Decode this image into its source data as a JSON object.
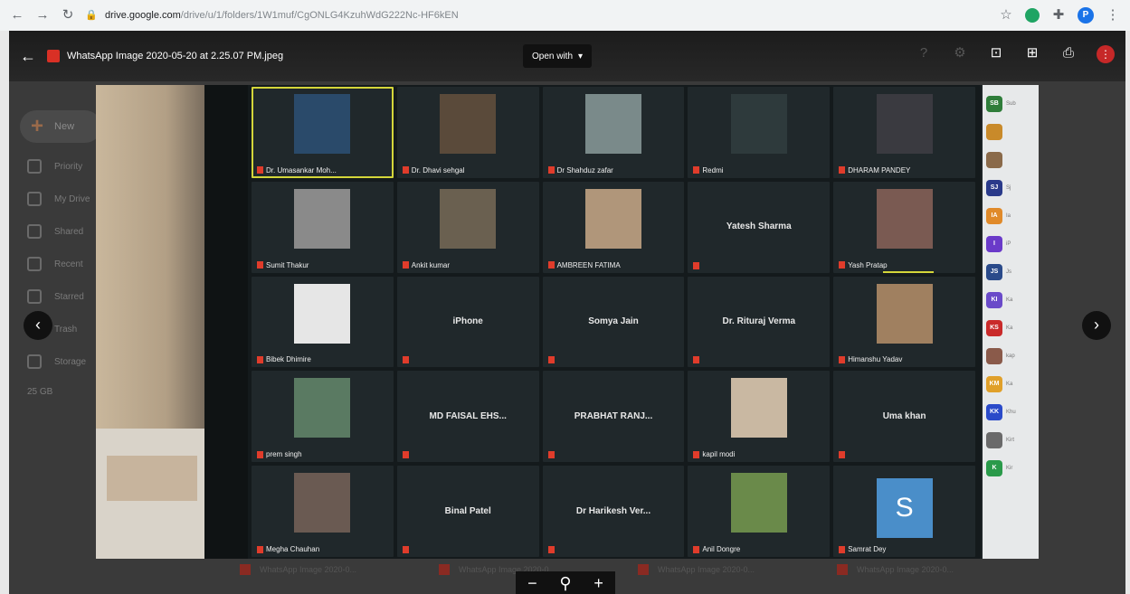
{
  "browser": {
    "url_host": "drive.google.com",
    "url_path": "/drive/u/1/folders/1W1muf/CgONLG4KzuhWdG222Nc-HF6kEN",
    "profile_initial": "P"
  },
  "viewer": {
    "file_title": "WhatsApp Image 2020-05-20 at 2.25.07 PM.jpeg",
    "open_with_label": "Open with",
    "open_with_caret": "▾",
    "back_icon": "←",
    "more_label": "⋮"
  },
  "drive_sidebar": {
    "new_label": "New",
    "items": [
      {
        "label": "Priority",
        "icon": "check-icon"
      },
      {
        "label": "My Drive",
        "icon": "drive-icon"
      },
      {
        "label": "Shared",
        "icon": "people-icon"
      },
      {
        "label": "Recent",
        "icon": "clock-icon"
      },
      {
        "label": "Starred",
        "icon": "star-icon"
      },
      {
        "label": "Trash",
        "icon": "trash-icon"
      },
      {
        "label": "Storage",
        "icon": "storage-icon"
      },
      {
        "label": "25 GB",
        "icon": ""
      }
    ]
  },
  "meeting_tiles": [
    {
      "name": "Dr. Umasankar Moh...",
      "type": "video",
      "color": "#2a4a6a",
      "active": true
    },
    {
      "name": "Dr. Dhavi sehgal",
      "type": "video",
      "color": "#5a4a3a"
    },
    {
      "name": "Dr Shahduz zafar",
      "type": "video",
      "color": "#7a8a8a"
    },
    {
      "name": "Redmi",
      "type": "video",
      "color": "#2e3a3c"
    },
    {
      "name": "DHARAM PANDEY",
      "type": "video",
      "color": "#3a3a40"
    },
    {
      "name": "Sumit Thakur",
      "type": "video",
      "color": "#8a8a8a"
    },
    {
      "name": "Ankit kumar",
      "type": "video",
      "color": "#6a6050"
    },
    {
      "name": "AMBREEN FATIMA",
      "type": "video",
      "color": "#b0967a"
    },
    {
      "name": "Yatesh Sharma",
      "type": "name"
    },
    {
      "name": "Yash Pratap",
      "type": "video",
      "color": "#7a5a52",
      "bar": true
    },
    {
      "name": "Bibek Dhimire",
      "type": "video",
      "color": "#e6e6e6"
    },
    {
      "name": "iPhone",
      "type": "name"
    },
    {
      "name": "Somya Jain",
      "type": "name"
    },
    {
      "name": "Dr. Rituraj Verma",
      "type": "name"
    },
    {
      "name": "Himanshu Yadav",
      "type": "video",
      "color": "#a08060"
    },
    {
      "name": "prem singh",
      "type": "video",
      "color": "#5a7a62"
    },
    {
      "name": "MD FAISAL EHS...",
      "type": "name"
    },
    {
      "name": "PRABHAT RANJ...",
      "type": "name"
    },
    {
      "name": "kapil modi",
      "type": "video",
      "color": "#c9b8a2"
    },
    {
      "name": "Uma khan",
      "type": "name"
    },
    {
      "name": "Megha Chauhan",
      "type": "video",
      "color": "#6a5a52"
    },
    {
      "name": "Binal Patel",
      "type": "name"
    },
    {
      "name": "Dr Harikesh Ver...",
      "type": "name"
    },
    {
      "name": "Anil Dongre",
      "type": "video",
      "color": "#6a8a4a"
    },
    {
      "name": "Samrat Dey",
      "type": "avatar",
      "initial": "S"
    }
  ],
  "participants_panel": [
    {
      "initials": "SB",
      "color": "#2f7d3a",
      "name": "Sub"
    },
    {
      "initials": "",
      "color": "#c98a2a",
      "name": ""
    },
    {
      "initials": "",
      "color": "#8a6a4a",
      "name": ""
    },
    {
      "initials": "SJ",
      "color": "#2a3a8a",
      "name": "Sj"
    },
    {
      "initials": "IA",
      "color": "#e08a2a",
      "name": "Ia"
    },
    {
      "initials": "I",
      "color": "#6a3ac9",
      "name": "iP"
    },
    {
      "initials": "JS",
      "color": "#2a4a8a",
      "name": "Js"
    },
    {
      "initials": "KI",
      "color": "#6a4ac9",
      "name": "Ka"
    },
    {
      "initials": "KS",
      "color": "#c92a2a",
      "name": "Ka"
    },
    {
      "initials": "",
      "color": "#8a5a4a",
      "name": "kap"
    },
    {
      "initials": "KM",
      "color": "#e0a02a",
      "name": "Ka"
    },
    {
      "initials": "KK",
      "color": "#2a4ac9",
      "name": "Khu"
    },
    {
      "initials": "",
      "color": "#6a6a6a",
      "name": "Kirt"
    },
    {
      "initials": "K",
      "color": "#2a9a4a",
      "name": "Kir"
    }
  ],
  "bottom_files": [
    "WhatsApp Image 2020-0...",
    "WhatsApp Image 2020-0...",
    "WhatsApp Image 2020-0...",
    "WhatsApp Image 2020-0..."
  ],
  "zoom": {
    "minus": "−",
    "search": "⚲",
    "plus": "+"
  },
  "nav": {
    "prev": "‹",
    "next": "›"
  }
}
